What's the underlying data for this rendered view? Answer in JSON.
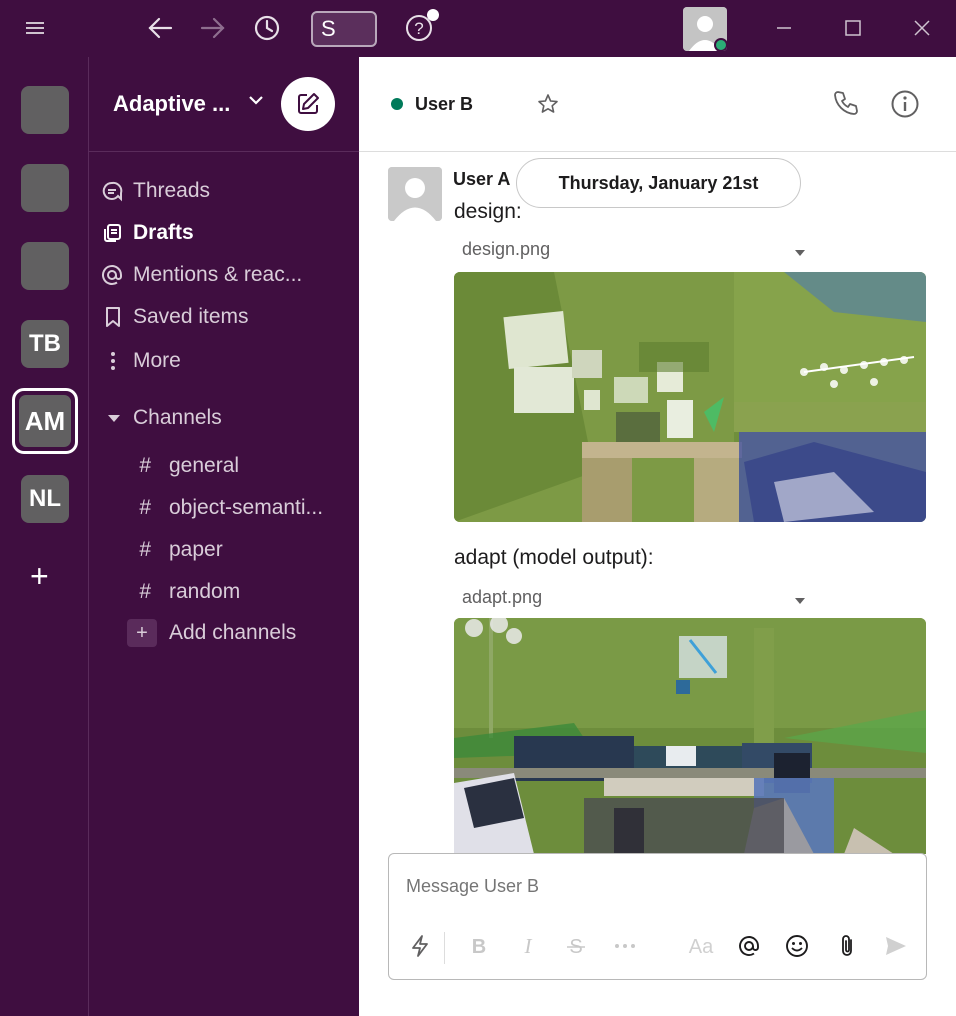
{
  "titlebar": {
    "icons": [
      "menu-icon",
      "back-arrow-icon",
      "forward-arrow-icon",
      "history-clock-icon",
      "help-icon",
      "minimize-icon",
      "maximize-icon",
      "close-icon"
    ],
    "search_value": "S"
  },
  "rail": {
    "workspaces": [
      {
        "label": ""
      },
      {
        "label": ""
      },
      {
        "label": ""
      },
      {
        "label": "TB"
      },
      {
        "label": "AM"
      },
      {
        "label": "NL"
      }
    ],
    "add_label": "+"
  },
  "sidebar": {
    "workspace_name": "Adaptive ...",
    "nav": [
      {
        "label": "Threads",
        "icon": "threads-icon"
      },
      {
        "label": "Drafts",
        "icon": "drafts-icon"
      },
      {
        "label": "Mentions & reac...",
        "icon": "mention-icon"
      },
      {
        "label": "Saved items",
        "icon": "bookmark-icon"
      },
      {
        "label": "More",
        "icon": "more-vertical-icon"
      }
    ],
    "channels_label": "Channels",
    "channels": [
      {
        "label": "general"
      },
      {
        "label": "object-semanti..."
      },
      {
        "label": "paper"
      },
      {
        "label": "random"
      }
    ],
    "add_channels_label": "Add channels",
    "hash": "#",
    "plus": "+"
  },
  "header": {
    "title": "User B"
  },
  "message": {
    "author": "User A",
    "date_divider": "Thursday, January 21st",
    "text1": "design:",
    "file1": "design.png",
    "text2": "adapt (model output):",
    "file2": "adapt.png"
  },
  "composer": {
    "placeholder": "Message User B",
    "tools": [
      "shortcuts-icon",
      "bold-icon",
      "italic-icon",
      "strikethrough-icon",
      "more-formatting-icon",
      "text-format-icon",
      "mention-icon",
      "emoji-icon",
      "attach-icon",
      "send-icon"
    ]
  },
  "colors": {
    "aubergine": "#3f0e40",
    "presence": "#007a5a",
    "online": "#2bac76"
  }
}
